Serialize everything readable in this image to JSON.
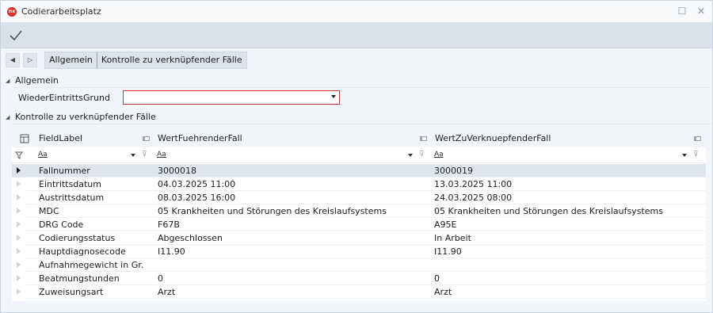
{
  "window": {
    "title": "Codierarbeitsplatz",
    "app_icon_text": "nx",
    "maximize_glyph": "☐",
    "close_glyph": "✕"
  },
  "toolbar": {
    "confirm_icon": "check-icon"
  },
  "tabs": {
    "prev_glyph": "◀",
    "next_glyph": "▷",
    "items": [
      {
        "label": "Allgemein"
      },
      {
        "label": "Kontrolle zu verknüpfender Fälle"
      }
    ]
  },
  "sections": {
    "allgemein": {
      "label": "Allgemein",
      "collapse_glyph": "◢"
    },
    "kontrolle": {
      "label": "Kontrolle zu verknüpfender Fälle",
      "collapse_glyph": "◢"
    }
  },
  "field": {
    "label": "WiederEintrittsGrund",
    "value": ""
  },
  "grid": {
    "columns": [
      {
        "label": "FieldLabel"
      },
      {
        "label": "WertFuehrenderFall"
      },
      {
        "label": "WertZuVerknuepfenderFall"
      }
    ],
    "filter_text": "Aa",
    "rows": [
      {
        "field": "Fallnummer",
        "a": "3000018",
        "b": "3000019"
      },
      {
        "field": "Eintrittsdatum",
        "a": "04.03.2025 11:00",
        "b": "13.03.2025 11:00"
      },
      {
        "field": "Austrittsdatum",
        "a": "08.03.2025 16:00",
        "b": "24.03.2025 08:00"
      },
      {
        "field": "MDC",
        "a": "05 Krankheiten und Störungen des Kreislaufsystems",
        "b": "05 Krankheiten und Störungen des Kreislaufsystems"
      },
      {
        "field": "DRG Code",
        "a": "F67B",
        "b": "A95E"
      },
      {
        "field": "Codierungsstatus",
        "a": "Abgeschlossen",
        "b": "In Arbeit"
      },
      {
        "field": "Hauptdiagnosecode",
        "a": "I11.90",
        "b": "I11.90"
      },
      {
        "field": "Aufnahmegewicht in Gr.",
        "a": "",
        "b": ""
      },
      {
        "field": "Beatmungstunden",
        "a": "0",
        "b": "0"
      },
      {
        "field": "Zuweisungsart",
        "a": "Arzt",
        "b": "Arzt"
      }
    ],
    "selected_row": 0
  }
}
